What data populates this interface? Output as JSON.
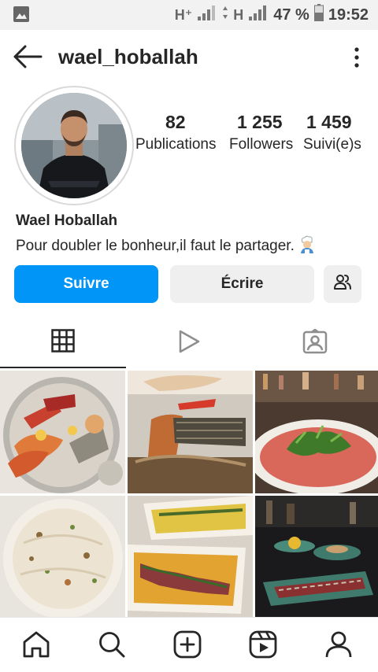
{
  "status_bar": {
    "network_1": "H⁺",
    "network_2": "H",
    "battery": "47 %",
    "time": "19:52"
  },
  "header": {
    "username": "wael_hoballah"
  },
  "profile": {
    "stats": [
      {
        "value": "82",
        "label": "Publications"
      },
      {
        "value": "1 255",
        "label": "Followers"
      },
      {
        "value": "1 459",
        "label": "Suivi(e)s"
      }
    ],
    "full_name": "Wael Hoballah",
    "bio": "Pour doubler le bonheur,il faut le partager."
  },
  "actions": {
    "follow": "Suivre",
    "message": "Écrire"
  },
  "tabs": {
    "active": "grid",
    "items": [
      "grid-icon",
      "reels-icon",
      "tagged-icon"
    ]
  },
  "colors": {
    "accent": "#0095f6",
    "secondary_button": "#efefef",
    "text": "#262626"
  }
}
